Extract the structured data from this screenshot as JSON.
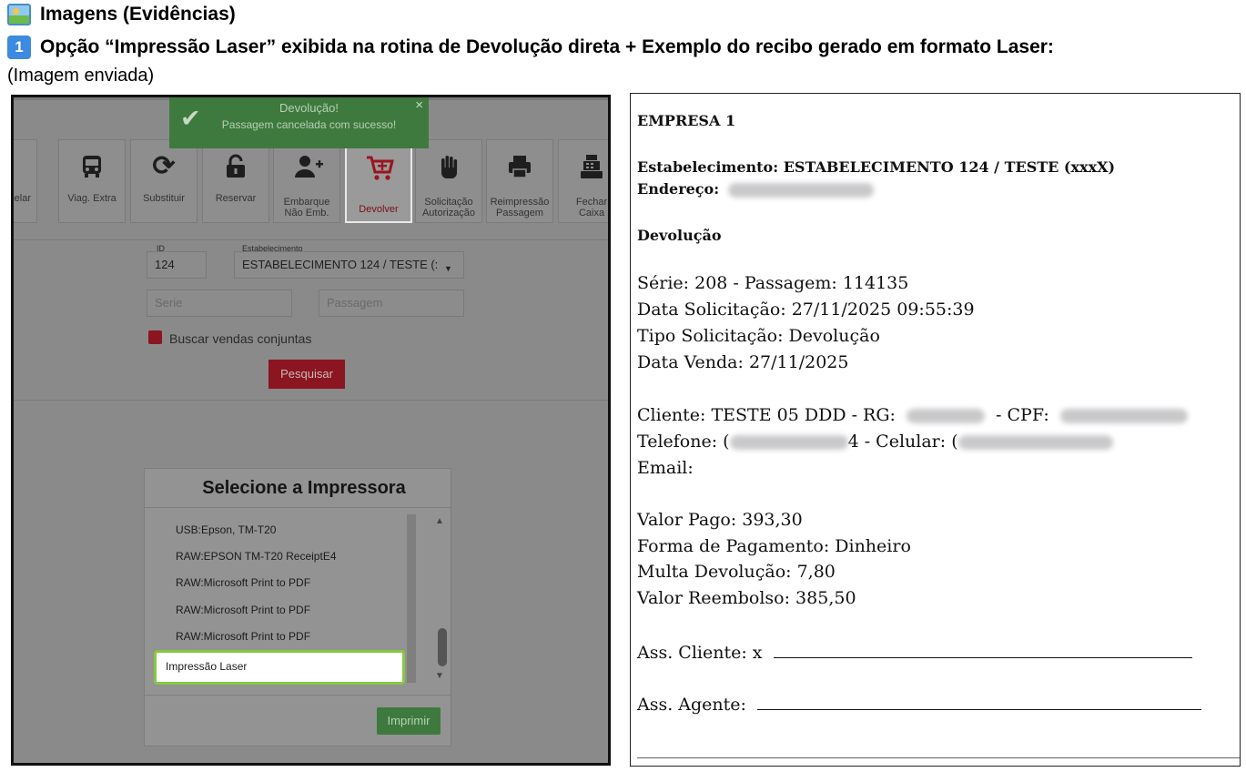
{
  "doc": {
    "heading1": "Imagens (Evidências)",
    "heading2_num": "1",
    "heading2": "Opção “Impressão Laser” exibida na rotina de Devolução direta + Exemplo do recibo gerado em formato Laser:",
    "caption": "(Imagem enviada)"
  },
  "toast": {
    "title": "Devolução!",
    "message": "Passagem cancelada com sucesso!",
    "close": "×"
  },
  "toolbar": {
    "items": [
      {
        "label": "ncelar",
        "icon": "cancel-circle-icon",
        "glyph": "⊗"
      },
      {
        "label": "Viag. Extra",
        "icon": "bus-icon",
        "glyph": "🚌"
      },
      {
        "label": "Substituir",
        "icon": "refresh-icon",
        "glyph": "⟳"
      },
      {
        "label": "Reservar",
        "icon": "unlock-icon",
        "glyph": "🔓"
      },
      {
        "label": "Embarque\nNão Emb.",
        "icon": "user-plus-icon",
        "glyph": "👤"
      },
      {
        "label": "Devolver",
        "icon": "cart-plus-icon",
        "glyph": "🛒"
      },
      {
        "label": "Solicitação\nAutorização",
        "icon": "hand-icon",
        "glyph": "✋"
      },
      {
        "label": "Reimpressão\nPassagem",
        "icon": "printer-icon",
        "glyph": "🖨"
      },
      {
        "label": "Fechar\nCaixa",
        "icon": "cash-register-icon",
        "glyph": "🖩"
      }
    ]
  },
  "form": {
    "id_label": "ID",
    "id_value": "124",
    "estab_label": "Estabelecimento",
    "estab_value": "ESTABELECIMENTO 124 / TESTE (:",
    "serie_placeholder": "Serie",
    "passagem_placeholder": "Passagem",
    "checkbox_label": "Buscar vendas conjuntas",
    "search_button": "Pesquisar"
  },
  "printer_dialog": {
    "title": "Selecione a Impressora",
    "options": [
      "USB:Epson, TM-T20",
      "RAW:EPSON TM-T20 ReceiptE4",
      "RAW:Microsoft Print to PDF",
      "RAW:Microsoft Print to PDF",
      "RAW:Microsoft Print to PDF"
    ],
    "selected_option": "Impressão Laser",
    "print_button": "Imprimir"
  },
  "receipt": {
    "company": "EMPRESA 1",
    "estab": "Estabelecimento: ESTABELECIMENTO 124 / TESTE (xxxX)",
    "address_label": "Endereço:",
    "section": "Devolução",
    "serie": "Série: 208 - Passagem: 114135",
    "data_solic": "Data Solicitação: 27/11/2025 09:55:39",
    "tipo_solic": "Tipo Solicitação: Devolução",
    "data_venda": "Data Venda: 27/11/2025",
    "cliente": "Cliente: TESTE 05 DDD - RG:",
    "cpf_label": "- CPF:",
    "telefone": "Telefone: (",
    "tel_end": "4",
    "celular": "- Celular: (",
    "email": "Email:",
    "valor_pago": "Valor Pago: 393,30",
    "forma_pag": "Forma de Pagamento: Dinheiro",
    "multa": "Multa Devolução: 7,80",
    "reembolso": "Valor Reembolso: 385,50",
    "ass_cliente": "Ass. Cliente: x",
    "ass_agente": "Ass. Agente:"
  }
}
